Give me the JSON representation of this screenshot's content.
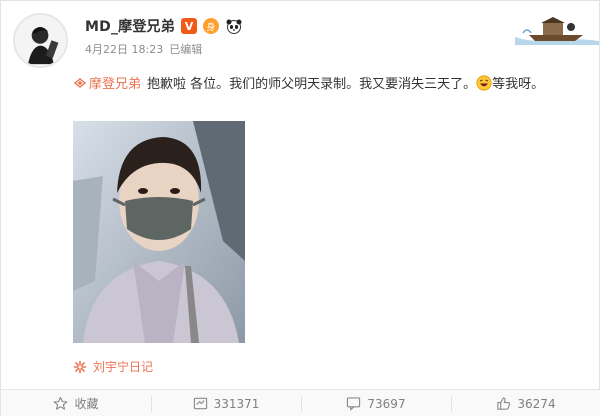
{
  "post": {
    "author_name": "MD_摩登兄弟",
    "vip_badge": "V",
    "badge2": "身",
    "timestamp": "4月22日 18:23",
    "edited_label": "已编辑",
    "mention": "摩登兄弟",
    "text_part1": "抱歉啦 各位。我们的师父明天录制。我又要消失三天了。",
    "text_part2": "等我呀。",
    "source": "刘宇宁日记"
  },
  "actions": {
    "favorite_label": "收藏",
    "repost_count": "331371",
    "comment_count": "73697",
    "like_count": "36274"
  },
  "colors": {
    "accent": "#eb7350",
    "vip": "#f25a1a",
    "text_muted": "#8c8c8c"
  },
  "icons": [
    "star-icon",
    "repost-icon",
    "comment-icon",
    "like-icon",
    "swirl-icon",
    "laugh-emoji-icon"
  ]
}
